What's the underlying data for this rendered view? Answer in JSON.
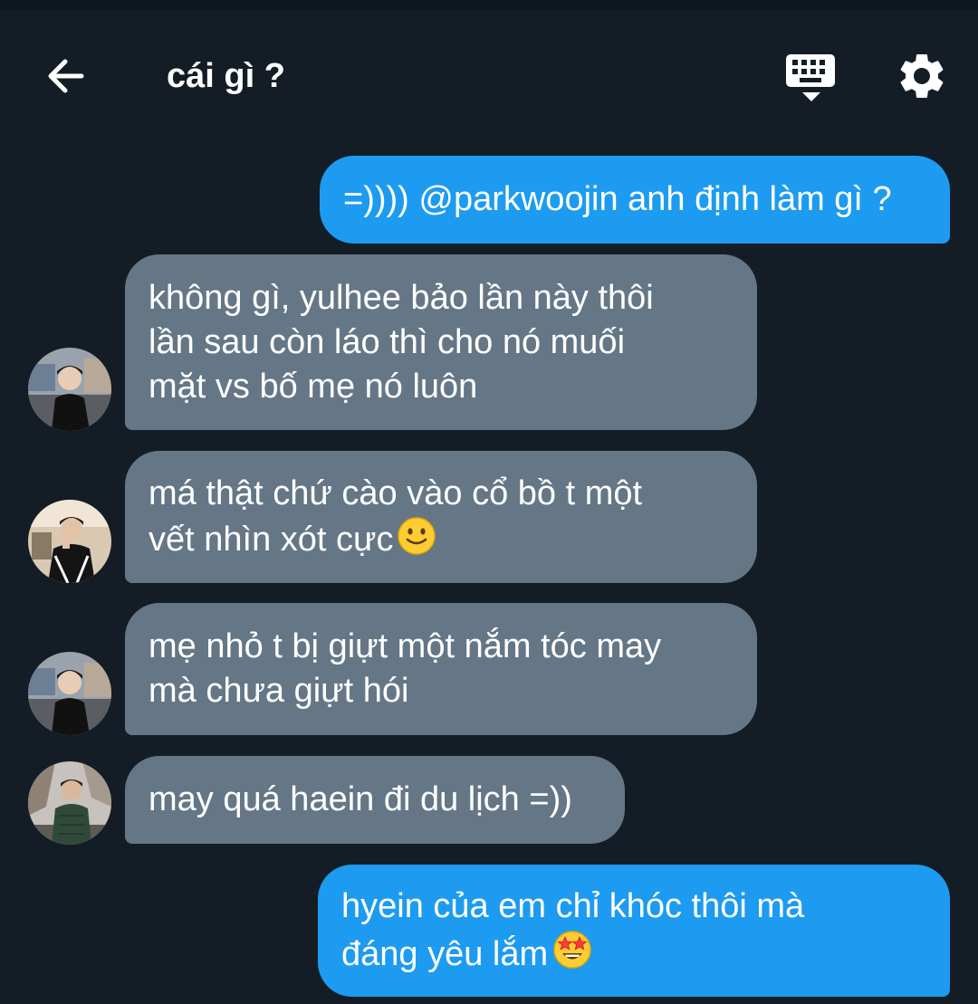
{
  "header": {
    "title": "cái gì ?",
    "back_icon": "arrow-left-icon",
    "keyboard_icon": "keyboard-hide-icon",
    "settings_icon": "gear-icon"
  },
  "colors": {
    "background": "#141d26",
    "outgoing_bubble": "#1d9bf0",
    "incoming_bubble": "#657786",
    "text": "#ffffff"
  },
  "messages": [
    {
      "direction": "outgoing",
      "text": "=)))) @parkwoojin anh định làm gì ?"
    },
    {
      "direction": "incoming",
      "text": "không gì, yulhee bảo lần này thôi\nlần sau còn láo thì cho nó muối\nmặt vs bố mẹ nó luôn"
    },
    {
      "direction": "incoming",
      "text": "má thật chứ cào vào cổ bồ t một\nvết nhìn xót cực",
      "emoji": "slightly-smiling-face"
    },
    {
      "direction": "incoming",
      "text": "mẹ nhỏ t bị giựt một nắm tóc may\nmà chưa giựt hói"
    },
    {
      "direction": "incoming",
      "text": "may quá haein đi du lịch =))"
    },
    {
      "direction": "outgoing",
      "text": "hyein của em chỉ khóc thôi mà\nđáng yêu lắm",
      "emoji": "star-struck-face"
    }
  ]
}
